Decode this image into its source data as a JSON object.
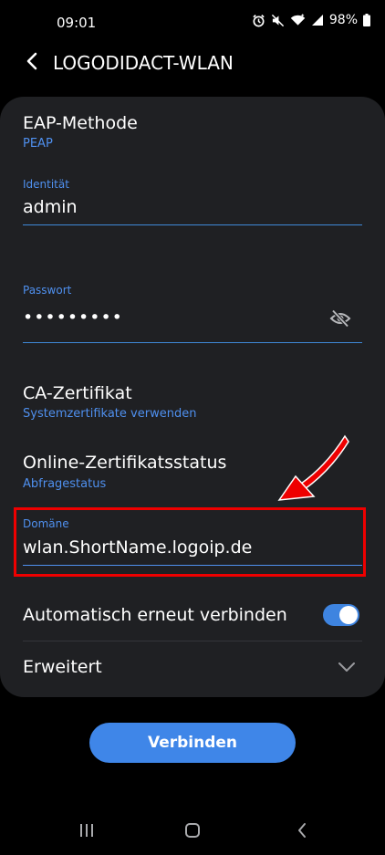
{
  "status_bar": {
    "time": "09:01",
    "battery": "98%",
    "icons": [
      "alarm-icon",
      "mute-icon",
      "wifi-icon",
      "signal-icon",
      "battery-icon"
    ]
  },
  "header": {
    "back_icon": "chevron-left-icon",
    "title": "LOGODIDACT-WLAN"
  },
  "form": {
    "eap": {
      "label": "EAP-Methode",
      "value": "PEAP"
    },
    "identity": {
      "label": "Identität",
      "value": "admin"
    },
    "password": {
      "label": "Passwort",
      "value": "•••••••••",
      "toggle_icon": "eye-off-icon"
    },
    "ca": {
      "label": "CA-Zertifikat",
      "value": "Systemzertifikate verwenden"
    },
    "ocsp": {
      "label": "Online-Zertifikatsstatus",
      "value": "Abfragestatus"
    },
    "domain": {
      "label": "Domäne",
      "value": "wlan.ShortName.logoip.de"
    },
    "auto_reconnect": {
      "label": "Automatisch erneut verbinden",
      "enabled": true
    },
    "advanced": {
      "label": "Erweitert",
      "icon": "chevron-down-icon"
    }
  },
  "connect_button": "Verbinden",
  "nav_bar": {
    "icons": [
      "recent-apps-icon",
      "home-icon",
      "back-icon"
    ]
  },
  "colors": {
    "background": "#000000",
    "card": "#1f2023",
    "accent": "#4f90ef",
    "annotation": "#ee0000"
  }
}
